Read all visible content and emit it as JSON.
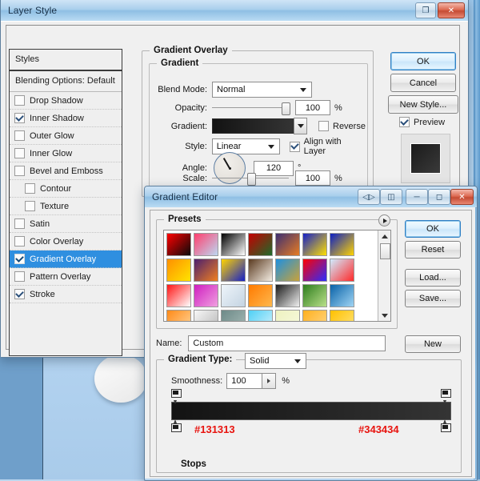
{
  "layer_style": {
    "title": "Layer Style",
    "titlebar_buttons": [
      "restore-icon",
      "close-icon"
    ],
    "styles_panel": {
      "header": "Styles",
      "blending_options": "Blending Options: Default",
      "items": [
        {
          "label": "Drop Shadow",
          "checked": false,
          "indent": false,
          "selected": false
        },
        {
          "label": "Inner Shadow",
          "checked": true,
          "indent": false,
          "selected": false
        },
        {
          "label": "Outer Glow",
          "checked": false,
          "indent": false,
          "selected": false
        },
        {
          "label": "Inner Glow",
          "checked": false,
          "indent": false,
          "selected": false
        },
        {
          "label": "Bevel and Emboss",
          "checked": false,
          "indent": false,
          "selected": false
        },
        {
          "label": "Contour",
          "checked": false,
          "indent": true,
          "selected": false
        },
        {
          "label": "Texture",
          "checked": false,
          "indent": true,
          "selected": false
        },
        {
          "label": "Satin",
          "checked": false,
          "indent": false,
          "selected": false
        },
        {
          "label": "Color Overlay",
          "checked": false,
          "indent": false,
          "selected": false
        },
        {
          "label": "Gradient Overlay",
          "checked": true,
          "indent": false,
          "selected": true
        },
        {
          "label": "Pattern Overlay",
          "checked": false,
          "indent": false,
          "selected": false
        },
        {
          "label": "Stroke",
          "checked": true,
          "indent": false,
          "selected": false
        }
      ]
    },
    "gradient_overlay": {
      "group_title": "Gradient Overlay",
      "sub_group_title": "Gradient",
      "blend_mode_label": "Blend Mode:",
      "blend_mode_value": "Normal",
      "opacity_label": "Opacity:",
      "opacity_value": "100",
      "opacity_unit": "%",
      "gradient_label": "Gradient:",
      "gradient_from": "#131313",
      "gradient_to": "#343434",
      "reverse_label": "Reverse",
      "reverse_checked": false,
      "style_label": "Style:",
      "style_value": "Linear",
      "align_label": "Align with Layer",
      "align_checked": true,
      "angle_label": "Angle:",
      "angle_value": "120",
      "angle_unit": "°",
      "scale_label": "Scale:",
      "scale_value": "100",
      "scale_unit": "%"
    },
    "buttons": {
      "ok": "OK",
      "cancel": "Cancel",
      "new_style": "New Style...",
      "preview_label": "Preview",
      "preview_checked": true
    }
  },
  "gradient_editor": {
    "title": "Gradient Editor",
    "titlebar_buttons": [
      "dock-toggle-icon",
      "panel-icon",
      "minimize-icon",
      "maximize-icon",
      "close-icon"
    ],
    "presets": {
      "title": "Presets",
      "menu_icon": "preset-menu-icon",
      "swatches": [
        {
          "from": "#ff0000",
          "to": "#0a0a0a"
        },
        {
          "from": "#ff3f6e",
          "to": "#bcd8f2"
        },
        {
          "from": "#000000",
          "to": "#ffffff"
        },
        {
          "from": "#c40000",
          "to": "#1d6b2a"
        },
        {
          "from": "#3c2f72",
          "to": "#e87c22"
        },
        {
          "from": "#1520c8",
          "to": "#ffe000"
        },
        {
          "from": "#0b1fc4",
          "to": "#ffd400"
        },
        {
          "from": "#ff9000",
          "to": "#ffe400"
        },
        {
          "from": "#4b1f6e",
          "to": "#f08020"
        },
        {
          "from": "#ffd400",
          "to": "#1520c8"
        },
        {
          "from": "#5a3a20",
          "to": "#f3ece2"
        },
        {
          "from": "#1e90e0",
          "to": "#c8a23a"
        },
        {
          "from": "#ff0000",
          "to": "#2c2cff"
        },
        {
          "from": "#d0ecff",
          "to": "#ff2a2a"
        },
        {
          "from": "#ff1515",
          "to": "#ffffff"
        },
        {
          "from": "#cf1fc0",
          "to": "#f0a0e0"
        },
        {
          "from": "#eef4fa",
          "to": "#c4d4e2"
        },
        {
          "from": "#ff7a00",
          "to": "#ffb84d"
        },
        {
          "from": "#1a1a1a",
          "to": "#f0f0f0"
        },
        {
          "from": "#2e7d1e",
          "to": "#b9e08a"
        },
        {
          "from": "#0a63a8",
          "to": "#9fd4f4"
        },
        {
          "from": "#ff8a18",
          "to": "#ffd9a0"
        },
        {
          "from": "#f7f7f7",
          "to": "#b4b4b4"
        },
        {
          "from": "#6d8a88",
          "to": "#a9bcb8"
        },
        {
          "from": "#4fd0f5",
          "to": "#d8f3fd"
        },
        {
          "from": "#eef2c0",
          "to": "#f8fadf"
        },
        {
          "from": "#ffb020",
          "to": "#ffd98a"
        },
        {
          "from": "#ffc000",
          "to": "#ffe680"
        },
        {
          "from": "#cfe0ee",
          "to": "#eef5fb"
        },
        {
          "from": "#9b3fd8",
          "to": "#d0a0f0"
        },
        {
          "from": "#9ad134",
          "to": "#c9e77f"
        },
        {
          "from": "#000000",
          "to": "#3a3a3a"
        }
      ]
    },
    "buttons": {
      "ok": "OK",
      "reset": "Reset",
      "load": "Load...",
      "save": "Save...",
      "new": "New"
    },
    "name_label": "Name:",
    "name_value": "Custom",
    "gradient_type_label": "Gradient Type:",
    "gradient_type_value": "Solid",
    "smoothness_label": "Smoothness:",
    "smoothness_value": "100",
    "smoothness_unit": "%",
    "gradient_bar": {
      "from": "#131313",
      "to": "#343434"
    },
    "color_stops": [
      {
        "hex": "#131313",
        "position": "left"
      },
      {
        "hex": "#343434",
        "position": "right"
      }
    ],
    "stops_label": "Stops"
  }
}
